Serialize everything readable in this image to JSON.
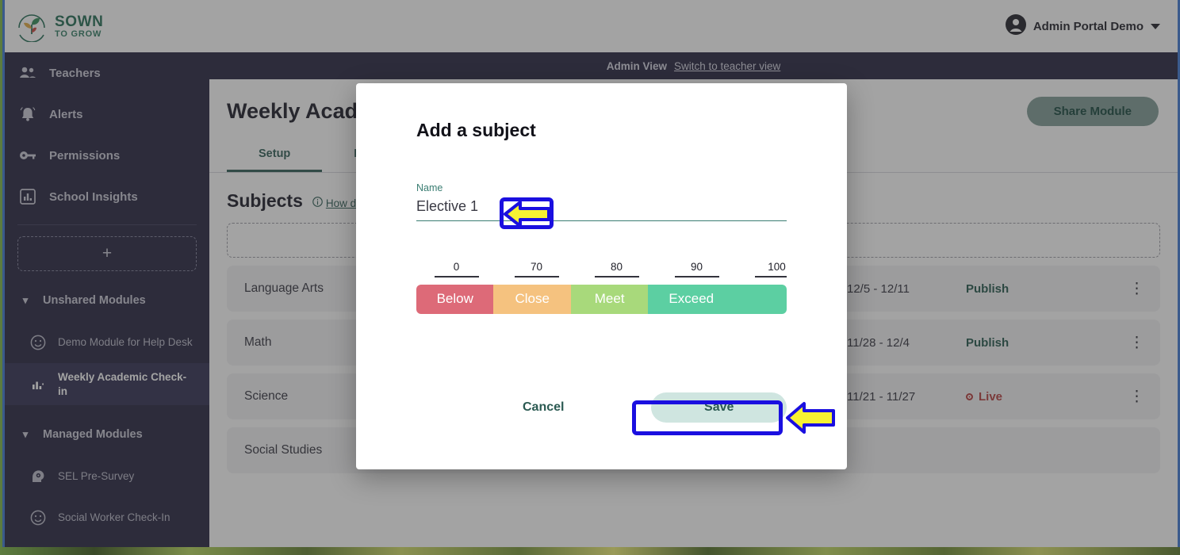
{
  "brand": {
    "name_line1": "SOWN",
    "name_line2": "TO GROW",
    "logo_icon": "plant-leaf-logo-icon"
  },
  "header": {
    "user_name": "Admin Portal Demo",
    "avatar_icon": "user-avatar-icon",
    "caret_icon": "chevron-down-icon"
  },
  "admin_bar": {
    "label": "Admin View",
    "switch_link": "Switch to teacher view"
  },
  "sidebar": {
    "items": [
      {
        "label": "Teachers",
        "icon": "people-icon"
      },
      {
        "label": "Alerts",
        "icon": "bell-icon"
      },
      {
        "label": "Permissions",
        "icon": "key-icon"
      },
      {
        "label": "School Insights",
        "icon": "bar-chart-icon"
      }
    ],
    "add_button": {
      "label": "+",
      "icon": "plus-icon"
    },
    "groups": [
      {
        "label": "Unshared Modules",
        "chevron": "chevron-down-icon",
        "items": [
          {
            "label": "Demo Module for Help Desk",
            "icon": "smiley-icon",
            "active": false
          },
          {
            "label": "Weekly Academic Check-in",
            "icon": "bar-chart-small-icon",
            "active": true
          }
        ]
      },
      {
        "label": "Managed Modules",
        "chevron": "chevron-down-icon",
        "items": [
          {
            "label": "SEL Pre-Survey",
            "icon": "head-brain-icon",
            "active": false
          },
          {
            "label": "Social Worker Check-In",
            "icon": "smiley-icon",
            "active": false
          }
        ]
      }
    ]
  },
  "main": {
    "page_title": "Weekly Academic Check-in",
    "share_button": "Share Module",
    "tabs": [
      {
        "label": "Setup",
        "active": true
      },
      {
        "label": "Results",
        "active": false
      }
    ],
    "subjects_section": {
      "title": "Subjects",
      "help_link": "How does this work?",
      "help_icon": "info-circle-icon",
      "add_row_label": "+",
      "add_row_icon": "plus-icon"
    },
    "table": {
      "rows": [
        {
          "subject": "Language Arts",
          "dates": "12/5 - 12/11",
          "status": "Publish",
          "status_type": "publish",
          "menu_icon": "kebab-menu-icon"
        },
        {
          "subject": "Math",
          "dates": "11/28 - 12/4",
          "status": "Publish",
          "status_type": "publish",
          "menu_icon": "kebab-menu-icon"
        },
        {
          "subject": "Science",
          "dates": "11/21 - 11/27",
          "status": "Live",
          "status_type": "live",
          "menu_icon": "kebab-menu-icon"
        },
        {
          "subject": "Social Studies",
          "dates": "",
          "status": "",
          "status_type": "none",
          "menu_icon": ""
        }
      ]
    }
  },
  "modal": {
    "title": "Add a subject",
    "name_field": {
      "label": "Name",
      "value": "Elective 1",
      "placeholder": ""
    },
    "scale": {
      "ticks": [
        "0",
        "70",
        "80",
        "90",
        "100"
      ],
      "bands": [
        {
          "label": "Below",
          "color": "#dd6a78"
        },
        {
          "label": "Close",
          "color": "#f5c27f"
        },
        {
          "label": "Meet",
          "color": "#a8d97b"
        },
        {
          "label": "Exceed",
          "color": "#5ccfa2"
        }
      ]
    },
    "cancel_button": "Cancel",
    "save_button": "Save"
  },
  "annotations": {
    "highlight_color": "#1a0fe0",
    "arrow_fill": "#f7f233",
    "targets": [
      "name-input",
      "save-button"
    ]
  }
}
